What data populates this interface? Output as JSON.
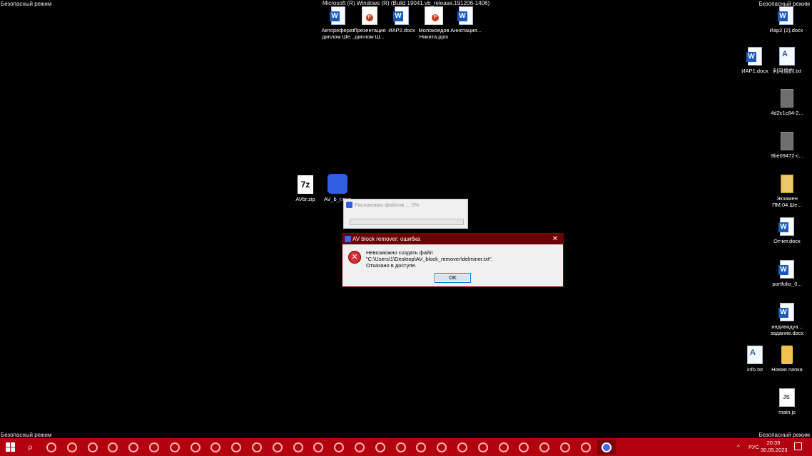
{
  "safe_mode": {
    "top_left": "Безопасный режим",
    "top_right": "Безопасный режим",
    "bottom_left": "Безопасный режим",
    "bottom_right": "Безопасный режим",
    "build": "Microsoft (R) Windows (R) (Build 19041.vb_release.191206-1406)"
  },
  "desktop_top": [
    {
      "label": "Автореферат диплом Ше...",
      "icon": "word-doc-icon"
    },
    {
      "label": "Презентация диплом Ш...",
      "icon": "powerpoint-doc-icon"
    },
    {
      "label": "ИАР2.docx",
      "icon": "word-doc-icon"
    },
    {
      "label": "Молокоедов Никита.pptx",
      "icon": "powerpoint-doc-icon"
    },
    {
      "label": "Аннотация...",
      "icon": "word-doc-icon"
    }
  ],
  "desktop_right": [
    {
      "label": "Иар2 (2).docx",
      "icon": "word-doc-icon"
    },
    {
      "label": "ИАР1.docx",
      "icon": "word-doc-icon"
    },
    {
      "label": "利用規約.txt",
      "icon": "text-file-icon"
    },
    {
      "label": "4d2c1c84-2...",
      "icon": "file-icon"
    },
    {
      "label": "9be09472-c...",
      "icon": "file-icon"
    },
    {
      "label": "Экзамен ПМ.04.Ше...",
      "icon": "zip-folder-icon"
    },
    {
      "label": "Отчет.docx",
      "icon": "word-doc-icon"
    },
    {
      "label": "portfolio_0...",
      "icon": "word-doc-icon"
    },
    {
      "label": "индивидуа... задание.docx",
      "icon": "word-doc-icon"
    },
    {
      "label": "info.txt",
      "icon": "text-file-icon"
    },
    {
      "label": "Новая папка",
      "icon": "folder-icon"
    },
    {
      "label": "main.js",
      "icon": "js-file-icon"
    }
  ],
  "desktop_center": [
    {
      "label": "AVbr.zip",
      "icon": "7zip-archive-icon",
      "glyph": "7z"
    },
    {
      "label": "AV_b_r.exe",
      "icon": "av-block-remover-icon"
    }
  ],
  "progress_window": {
    "title": "Распаковка файлов ... 0%",
    "progress": 0
  },
  "error_dialog": {
    "title": "AV block remover: ошибка",
    "close_glyph": "✕",
    "error_glyph": "✕",
    "message_line1": "Невозможно создать файл \"C:\\Users\\1\\Desktop\\AV_block_remover\\delminer.txt\".",
    "message_line2": "Отказано в доступе.",
    "ok_label": "OK"
  },
  "taskbar": {
    "search_glyph": "⌕",
    "apps": [
      "",
      "",
      "",
      "",
      "",
      "",
      "",
      "",
      "",
      "",
      "",
      "",
      "",
      "",
      "",
      "",
      "",
      "",
      "",
      "",
      "",
      "",
      "",
      "",
      "",
      "",
      "",
      ""
    ],
    "tray_arrow": "^",
    "lang": "РУС",
    "time": "20:39",
    "date": "30.05.2023"
  },
  "colors": {
    "taskbar": "#b3000e",
    "dialog_title": "#6b0000",
    "accent": "#0078d7"
  }
}
